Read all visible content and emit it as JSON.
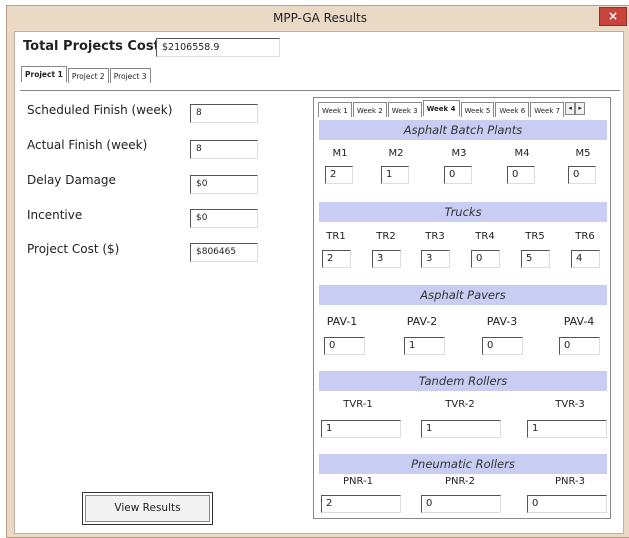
{
  "window": {
    "title": "MPP-GA Results",
    "close_symbol": "×"
  },
  "total": {
    "label": "Total Projects Cost",
    "value": "$2106558.9"
  },
  "project_tabs": [
    "Project 1",
    "Project 2",
    "Project 3"
  ],
  "project": {
    "fields": [
      {
        "label": "Scheduled Finish (week)",
        "value": "8"
      },
      {
        "label": "Actual Finish (week)",
        "value": "8"
      },
      {
        "label": "Delay Damage",
        "value": "$0"
      },
      {
        "label": "Incentive",
        "value": "$0"
      },
      {
        "label": "Project Cost ($)",
        "value": "$806465"
      }
    ],
    "view_button": "View Results"
  },
  "week_tabs": [
    "Week 1",
    "Week 2",
    "Week 3",
    "Week 4",
    "Week 5",
    "Week 6",
    "Week 7"
  ],
  "scroll": {
    "left": "◂",
    "right": "▸"
  },
  "sections": {
    "asphalt_plants": {
      "title": "Asphalt Batch Plants",
      "labels": [
        "M1",
        "M2",
        "M3",
        "M4",
        "M5"
      ],
      "values": [
        "2",
        "1",
        "0",
        "0",
        "0"
      ]
    },
    "trucks": {
      "title": "Trucks",
      "labels": [
        "TR1",
        "TR2",
        "TR3",
        "TR4",
        "TR5",
        "TR6"
      ],
      "values": [
        "2",
        "3",
        "3",
        "0",
        "5",
        "4"
      ]
    },
    "pavers": {
      "title": "Asphalt Pavers",
      "labels": [
        "PAV-1",
        "PAV-2",
        "PAV-3",
        "PAV-4"
      ],
      "values": [
        "0",
        "1",
        "0",
        "0"
      ]
    },
    "tandem_rollers": {
      "title": "Tandem Rollers",
      "labels": [
        "TVR-1",
        "TVR-2",
        "TVR-3"
      ],
      "values": [
        "1",
        "1",
        "1"
      ]
    },
    "pneumatic_rollers": {
      "title": "Pneumatic Rollers",
      "labels": [
        "PNR-1",
        "PNR-2",
        "PNR-3"
      ],
      "values": [
        "2",
        "0",
        "0"
      ]
    }
  }
}
